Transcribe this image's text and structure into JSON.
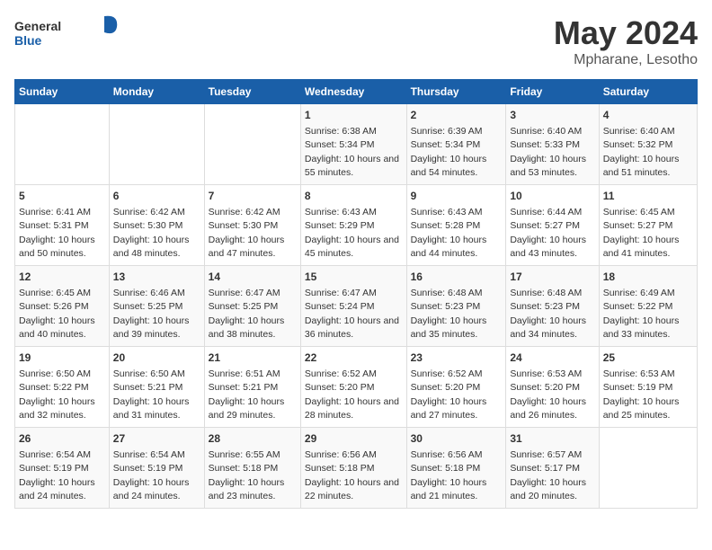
{
  "header": {
    "logo_general": "General",
    "logo_blue": "Blue",
    "title": "May 2024",
    "subtitle": "Mpharane, Lesotho"
  },
  "days_of_week": [
    "Sunday",
    "Monday",
    "Tuesday",
    "Wednesday",
    "Thursday",
    "Friday",
    "Saturday"
  ],
  "weeks": [
    {
      "days": [
        {
          "num": "",
          "sunrise": "",
          "sunset": "",
          "daylight": ""
        },
        {
          "num": "",
          "sunrise": "",
          "sunset": "",
          "daylight": ""
        },
        {
          "num": "",
          "sunrise": "",
          "sunset": "",
          "daylight": ""
        },
        {
          "num": "1",
          "sunrise": "Sunrise: 6:38 AM",
          "sunset": "Sunset: 5:34 PM",
          "daylight": "Daylight: 10 hours and 55 minutes."
        },
        {
          "num": "2",
          "sunrise": "Sunrise: 6:39 AM",
          "sunset": "Sunset: 5:34 PM",
          "daylight": "Daylight: 10 hours and 54 minutes."
        },
        {
          "num": "3",
          "sunrise": "Sunrise: 6:40 AM",
          "sunset": "Sunset: 5:33 PM",
          "daylight": "Daylight: 10 hours and 53 minutes."
        },
        {
          "num": "4",
          "sunrise": "Sunrise: 6:40 AM",
          "sunset": "Sunset: 5:32 PM",
          "daylight": "Daylight: 10 hours and 51 minutes."
        }
      ]
    },
    {
      "days": [
        {
          "num": "5",
          "sunrise": "Sunrise: 6:41 AM",
          "sunset": "Sunset: 5:31 PM",
          "daylight": "Daylight: 10 hours and 50 minutes."
        },
        {
          "num": "6",
          "sunrise": "Sunrise: 6:42 AM",
          "sunset": "Sunset: 5:30 PM",
          "daylight": "Daylight: 10 hours and 48 minutes."
        },
        {
          "num": "7",
          "sunrise": "Sunrise: 6:42 AM",
          "sunset": "Sunset: 5:30 PM",
          "daylight": "Daylight: 10 hours and 47 minutes."
        },
        {
          "num": "8",
          "sunrise": "Sunrise: 6:43 AM",
          "sunset": "Sunset: 5:29 PM",
          "daylight": "Daylight: 10 hours and 45 minutes."
        },
        {
          "num": "9",
          "sunrise": "Sunrise: 6:43 AM",
          "sunset": "Sunset: 5:28 PM",
          "daylight": "Daylight: 10 hours and 44 minutes."
        },
        {
          "num": "10",
          "sunrise": "Sunrise: 6:44 AM",
          "sunset": "Sunset: 5:27 PM",
          "daylight": "Daylight: 10 hours and 43 minutes."
        },
        {
          "num": "11",
          "sunrise": "Sunrise: 6:45 AM",
          "sunset": "Sunset: 5:27 PM",
          "daylight": "Daylight: 10 hours and 41 minutes."
        }
      ]
    },
    {
      "days": [
        {
          "num": "12",
          "sunrise": "Sunrise: 6:45 AM",
          "sunset": "Sunset: 5:26 PM",
          "daylight": "Daylight: 10 hours and 40 minutes."
        },
        {
          "num": "13",
          "sunrise": "Sunrise: 6:46 AM",
          "sunset": "Sunset: 5:25 PM",
          "daylight": "Daylight: 10 hours and 39 minutes."
        },
        {
          "num": "14",
          "sunrise": "Sunrise: 6:47 AM",
          "sunset": "Sunset: 5:25 PM",
          "daylight": "Daylight: 10 hours and 38 minutes."
        },
        {
          "num": "15",
          "sunrise": "Sunrise: 6:47 AM",
          "sunset": "Sunset: 5:24 PM",
          "daylight": "Daylight: 10 hours and 36 minutes."
        },
        {
          "num": "16",
          "sunrise": "Sunrise: 6:48 AM",
          "sunset": "Sunset: 5:23 PM",
          "daylight": "Daylight: 10 hours and 35 minutes."
        },
        {
          "num": "17",
          "sunrise": "Sunrise: 6:48 AM",
          "sunset": "Sunset: 5:23 PM",
          "daylight": "Daylight: 10 hours and 34 minutes."
        },
        {
          "num": "18",
          "sunrise": "Sunrise: 6:49 AM",
          "sunset": "Sunset: 5:22 PM",
          "daylight": "Daylight: 10 hours and 33 minutes."
        }
      ]
    },
    {
      "days": [
        {
          "num": "19",
          "sunrise": "Sunrise: 6:50 AM",
          "sunset": "Sunset: 5:22 PM",
          "daylight": "Daylight: 10 hours and 32 minutes."
        },
        {
          "num": "20",
          "sunrise": "Sunrise: 6:50 AM",
          "sunset": "Sunset: 5:21 PM",
          "daylight": "Daylight: 10 hours and 31 minutes."
        },
        {
          "num": "21",
          "sunrise": "Sunrise: 6:51 AM",
          "sunset": "Sunset: 5:21 PM",
          "daylight": "Daylight: 10 hours and 29 minutes."
        },
        {
          "num": "22",
          "sunrise": "Sunrise: 6:52 AM",
          "sunset": "Sunset: 5:20 PM",
          "daylight": "Daylight: 10 hours and 28 minutes."
        },
        {
          "num": "23",
          "sunrise": "Sunrise: 6:52 AM",
          "sunset": "Sunset: 5:20 PM",
          "daylight": "Daylight: 10 hours and 27 minutes."
        },
        {
          "num": "24",
          "sunrise": "Sunrise: 6:53 AM",
          "sunset": "Sunset: 5:20 PM",
          "daylight": "Daylight: 10 hours and 26 minutes."
        },
        {
          "num": "25",
          "sunrise": "Sunrise: 6:53 AM",
          "sunset": "Sunset: 5:19 PM",
          "daylight": "Daylight: 10 hours and 25 minutes."
        }
      ]
    },
    {
      "days": [
        {
          "num": "26",
          "sunrise": "Sunrise: 6:54 AM",
          "sunset": "Sunset: 5:19 PM",
          "daylight": "Daylight: 10 hours and 24 minutes."
        },
        {
          "num": "27",
          "sunrise": "Sunrise: 6:54 AM",
          "sunset": "Sunset: 5:19 PM",
          "daylight": "Daylight: 10 hours and 24 minutes."
        },
        {
          "num": "28",
          "sunrise": "Sunrise: 6:55 AM",
          "sunset": "Sunset: 5:18 PM",
          "daylight": "Daylight: 10 hours and 23 minutes."
        },
        {
          "num": "29",
          "sunrise": "Sunrise: 6:56 AM",
          "sunset": "Sunset: 5:18 PM",
          "daylight": "Daylight: 10 hours and 22 minutes."
        },
        {
          "num": "30",
          "sunrise": "Sunrise: 6:56 AM",
          "sunset": "Sunset: 5:18 PM",
          "daylight": "Daylight: 10 hours and 21 minutes."
        },
        {
          "num": "31",
          "sunrise": "Sunrise: 6:57 AM",
          "sunset": "Sunset: 5:17 PM",
          "daylight": "Daylight: 10 hours and 20 minutes."
        },
        {
          "num": "",
          "sunrise": "",
          "sunset": "",
          "daylight": ""
        }
      ]
    }
  ]
}
